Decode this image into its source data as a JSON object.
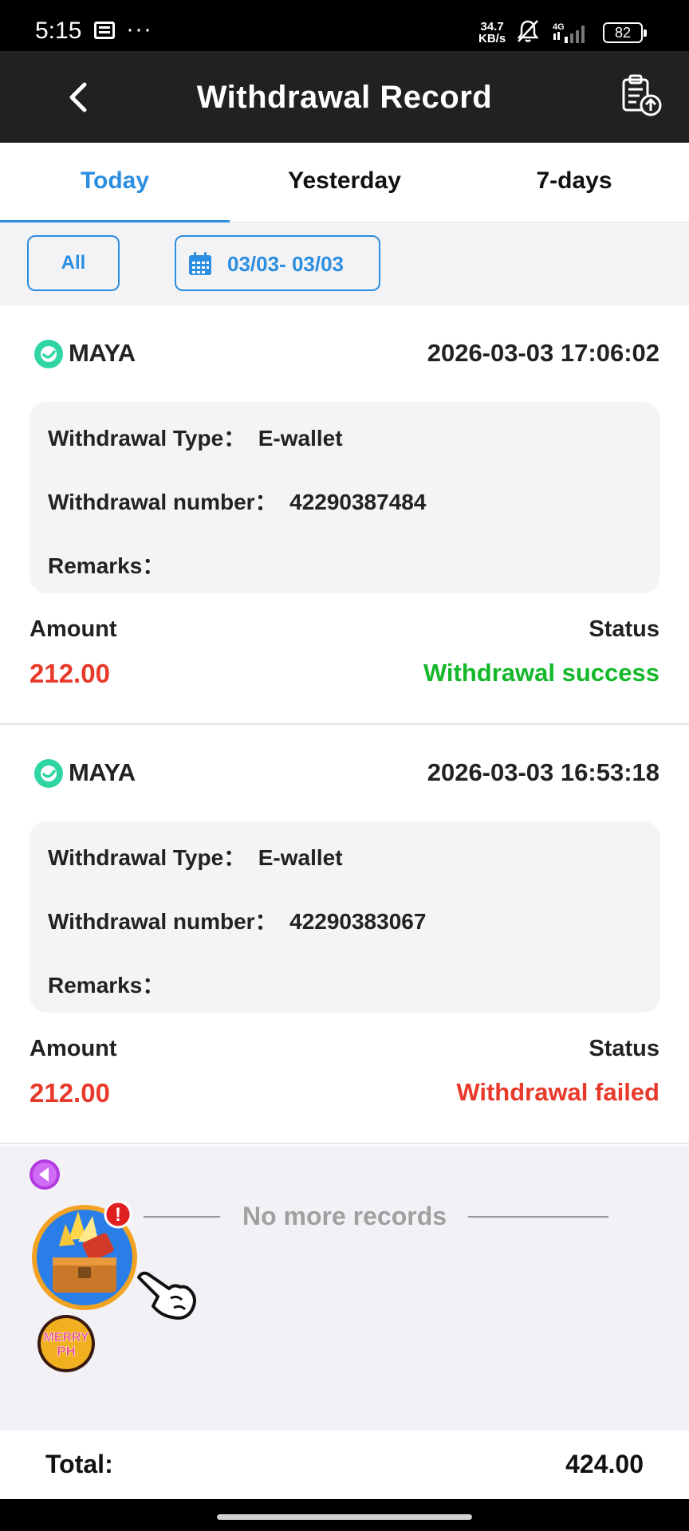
{
  "status_bar": {
    "time": "5:15",
    "dots": "···",
    "speed_value": "34.7",
    "speed_unit": "KB/s",
    "network": "4G",
    "battery": "82"
  },
  "header": {
    "title": "Withdrawal Record",
    "back_icon": "chevron-left-icon",
    "export_icon": "clipboard-upload-icon"
  },
  "tabs": [
    {
      "label": "Today",
      "active": true
    },
    {
      "label": "Yesterday",
      "active": false
    },
    {
      "label": "7-days",
      "active": false
    }
  ],
  "filters": {
    "all_label": "All",
    "date_range": "03/03- 03/03",
    "accent_color": "#2c8ee0"
  },
  "records": [
    {
      "method": "MAYA",
      "datetime": "2026-03-03 17:06:02",
      "type_label": "Withdrawal Type：",
      "type_value": "E-wallet",
      "number_label": "Withdrawal number：",
      "number_value": "42290387484",
      "remarks_label": "Remarks：",
      "remarks_value": "",
      "amount_label": "Amount",
      "amount": "212.00",
      "status_label": "Status",
      "status": "Withdrawal success",
      "status_color": "#14b82a"
    },
    {
      "method": "MAYA",
      "datetime": "2026-03-03 16:53:18",
      "type_label": "Withdrawal Type：",
      "type_value": "E-wallet",
      "number_label": "Withdrawal number：",
      "number_value": "42290383067",
      "remarks_label": "Remarks：",
      "remarks_value": "",
      "amount_label": "Amount",
      "amount": "212.00",
      "status_label": "Status",
      "status": "Withdrawal failed",
      "status_color": "#e8392b"
    }
  ],
  "end_message": "No more records",
  "promo": {
    "badge_text_1": "MERRY",
    "badge_text_2": "PH",
    "alert": "!"
  },
  "total": {
    "label": "Total:",
    "value": "424.00"
  }
}
